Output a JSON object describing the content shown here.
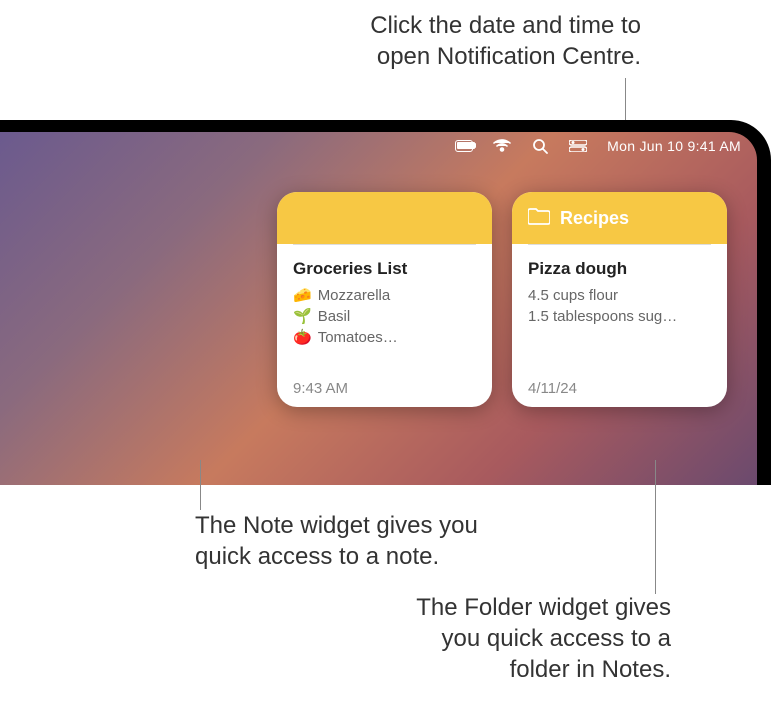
{
  "callouts": {
    "top": {
      "line1": "Click the date and time to",
      "line2": "open Notification Centre."
    },
    "mid": {
      "line1": "The Note widget gives you",
      "line2": "quick access to a note."
    },
    "bot": {
      "line1": "The Folder widget gives",
      "line2": "you quick access to a",
      "line3": "folder in Notes."
    }
  },
  "menubar": {
    "datetime": "Mon Jun 10  9:41 AM"
  },
  "widgets": {
    "note": {
      "title": "Groceries List",
      "items": [
        {
          "emoji": "🧀",
          "text": "Mozzarella"
        },
        {
          "emoji": "🌱",
          "text": "Basil"
        },
        {
          "emoji": "🍅",
          "text": "Tomatoes…"
        }
      ],
      "time": "9:43 AM"
    },
    "folder": {
      "header": "Recipes",
      "title": "Pizza dough",
      "lines": [
        "4.5 cups flour",
        "1.5 tablespoons sug…"
      ],
      "time": "4/11/24"
    }
  }
}
